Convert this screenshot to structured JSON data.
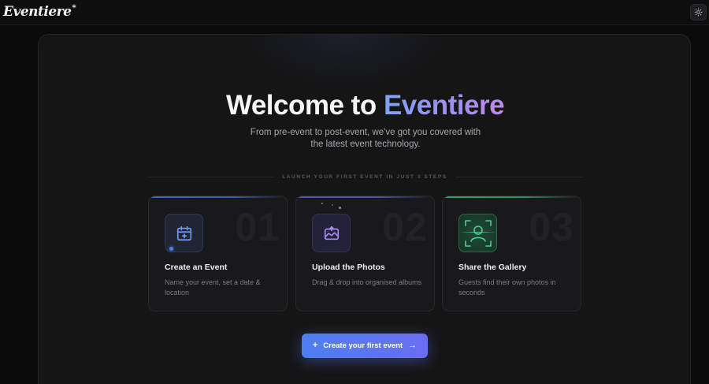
{
  "app": {
    "logo": "Eventiere",
    "logo_mark": "*"
  },
  "hero": {
    "title_prefix": "Welcome to ",
    "title_brand": "Eventiere",
    "subtitle": "From pre-event to post-event, we've got you covered with the latest event technology."
  },
  "steps": {
    "label": "LAUNCH YOUR FIRST EVENT IN JUST 3 STEPS",
    "items": [
      {
        "number": "01",
        "title": "Create an Event",
        "description": "Name your event, set a date & location",
        "icon": "calendar-plus-icon",
        "accent": "#3f63c9"
      },
      {
        "number": "02",
        "title": "Upload the Photos",
        "description": "Drag & drop into organised albums",
        "icon": "image-upload-icon",
        "accent": "#5553b7"
      },
      {
        "number": "03",
        "title": "Share the Gallery",
        "description": "Guests find their own photos in seconds",
        "icon": "user-scan-icon",
        "accent": "#25a56b"
      }
    ]
  },
  "cta": {
    "label": "Create your first event",
    "plus_glyph": "+",
    "arrow_glyph": "→",
    "gradient": [
      "#4e7fee",
      "#6a6ef0"
    ]
  },
  "colors": {
    "background": "#0b0b0c",
    "panel": "#151516",
    "brand_gradient": [
      "#7fa4f2",
      "#a08ef0",
      "#c08ae8"
    ]
  }
}
